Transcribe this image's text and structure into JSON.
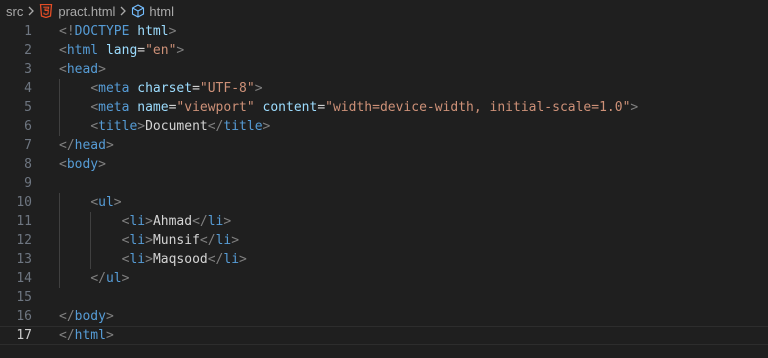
{
  "breadcrumb": {
    "folder": "src",
    "file": "pract.html",
    "symbol": "html"
  },
  "editor": {
    "current_line": 17,
    "lines": [
      {
        "n": "1",
        "indent": 0,
        "tokens": [
          {
            "t": "<!",
            "c": "punct"
          },
          {
            "t": "DOCTYPE",
            "c": "doctype"
          },
          {
            "t": " ",
            "c": "text"
          },
          {
            "t": "html",
            "c": "attr"
          },
          {
            "t": ">",
            "c": "punct"
          }
        ]
      },
      {
        "n": "2",
        "indent": 0,
        "tokens": [
          {
            "t": "<",
            "c": "punct"
          },
          {
            "t": "html",
            "c": "tag"
          },
          {
            "t": " ",
            "c": "text"
          },
          {
            "t": "lang",
            "c": "attr"
          },
          {
            "t": "=",
            "c": "text"
          },
          {
            "t": "\"en\"",
            "c": "str"
          },
          {
            "t": ">",
            "c": "punct"
          }
        ]
      },
      {
        "n": "3",
        "indent": 0,
        "tokens": [
          {
            "t": "<",
            "c": "punct"
          },
          {
            "t": "head",
            "c": "tag"
          },
          {
            "t": ">",
            "c": "punct"
          }
        ]
      },
      {
        "n": "4",
        "indent": 1,
        "tokens": [
          {
            "t": "<",
            "c": "punct"
          },
          {
            "t": "meta",
            "c": "tag"
          },
          {
            "t": " ",
            "c": "text"
          },
          {
            "t": "charset",
            "c": "attr"
          },
          {
            "t": "=",
            "c": "text"
          },
          {
            "t": "\"UTF-8\"",
            "c": "str"
          },
          {
            "t": ">",
            "c": "punct"
          }
        ]
      },
      {
        "n": "5",
        "indent": 1,
        "tokens": [
          {
            "t": "<",
            "c": "punct"
          },
          {
            "t": "meta",
            "c": "tag"
          },
          {
            "t": " ",
            "c": "text"
          },
          {
            "t": "name",
            "c": "attr"
          },
          {
            "t": "=",
            "c": "text"
          },
          {
            "t": "\"viewport\"",
            "c": "str"
          },
          {
            "t": " ",
            "c": "text"
          },
          {
            "t": "content",
            "c": "attr"
          },
          {
            "t": "=",
            "c": "text"
          },
          {
            "t": "\"width=device-width, initial-scale=1.0\"",
            "c": "str"
          },
          {
            "t": ">",
            "c": "punct"
          }
        ]
      },
      {
        "n": "6",
        "indent": 1,
        "tokens": [
          {
            "t": "<",
            "c": "punct"
          },
          {
            "t": "title",
            "c": "tag"
          },
          {
            "t": ">",
            "c": "punct"
          },
          {
            "t": "Document",
            "c": "text"
          },
          {
            "t": "</",
            "c": "punct"
          },
          {
            "t": "title",
            "c": "tag"
          },
          {
            "t": ">",
            "c": "punct"
          }
        ]
      },
      {
        "n": "7",
        "indent": 0,
        "tokens": [
          {
            "t": "</",
            "c": "punct"
          },
          {
            "t": "head",
            "c": "tag"
          },
          {
            "t": ">",
            "c": "punct"
          }
        ]
      },
      {
        "n": "8",
        "indent": 0,
        "tokens": [
          {
            "t": "<",
            "c": "punct"
          },
          {
            "t": "body",
            "c": "tag"
          },
          {
            "t": ">",
            "c": "punct"
          }
        ]
      },
      {
        "n": "9",
        "indent": 0,
        "tokens": []
      },
      {
        "n": "10",
        "indent": 1,
        "tokens": [
          {
            "t": "<",
            "c": "punct"
          },
          {
            "t": "ul",
            "c": "tag"
          },
          {
            "t": ">",
            "c": "punct"
          }
        ]
      },
      {
        "n": "11",
        "indent": 2,
        "tokens": [
          {
            "t": "<",
            "c": "punct"
          },
          {
            "t": "li",
            "c": "tag"
          },
          {
            "t": ">",
            "c": "punct"
          },
          {
            "t": "Ahmad",
            "c": "text"
          },
          {
            "t": "</",
            "c": "punct"
          },
          {
            "t": "li",
            "c": "tag"
          },
          {
            "t": ">",
            "c": "punct"
          }
        ]
      },
      {
        "n": "12",
        "indent": 2,
        "tokens": [
          {
            "t": "<",
            "c": "punct"
          },
          {
            "t": "li",
            "c": "tag"
          },
          {
            "t": ">",
            "c": "punct"
          },
          {
            "t": "Munsif",
            "c": "text"
          },
          {
            "t": "</",
            "c": "punct"
          },
          {
            "t": "li",
            "c": "tag"
          },
          {
            "t": ">",
            "c": "punct"
          }
        ]
      },
      {
        "n": "13",
        "indent": 2,
        "tokens": [
          {
            "t": "<",
            "c": "punct"
          },
          {
            "t": "li",
            "c": "tag"
          },
          {
            "t": ">",
            "c": "punct"
          },
          {
            "t": "Maqsood",
            "c": "text"
          },
          {
            "t": "</",
            "c": "punct"
          },
          {
            "t": "li",
            "c": "tag"
          },
          {
            "t": ">",
            "c": "punct"
          }
        ]
      },
      {
        "n": "14",
        "indent": 1,
        "tokens": [
          {
            "t": "</",
            "c": "punct"
          },
          {
            "t": "ul",
            "c": "tag"
          },
          {
            "t": ">",
            "c": "punct"
          }
        ]
      },
      {
        "n": "15",
        "indent": 0,
        "tokens": []
      },
      {
        "n": "16",
        "indent": 0,
        "tokens": [
          {
            "t": "</",
            "c": "punct"
          },
          {
            "t": "body",
            "c": "tag"
          },
          {
            "t": ">",
            "c": "punct"
          }
        ]
      },
      {
        "n": "17",
        "indent": 0,
        "tokens": [
          {
            "t": "</",
            "c": "punct"
          },
          {
            "t": "html",
            "c": "tag"
          },
          {
            "t": ">",
            "c": "punct"
          }
        ]
      }
    ]
  },
  "colors": {
    "background": "#1f1f1f",
    "tag": "#569cd6",
    "attribute": "#9cdcfe",
    "string": "#ce9178",
    "bracket": "#808080",
    "text": "#d4d4d4",
    "html5_icon": "#e44d26"
  },
  "icons": {
    "file_icon": "html5-icon",
    "symbol_icon": "cube-icon",
    "separator_icon": "chevron-right-icon"
  }
}
